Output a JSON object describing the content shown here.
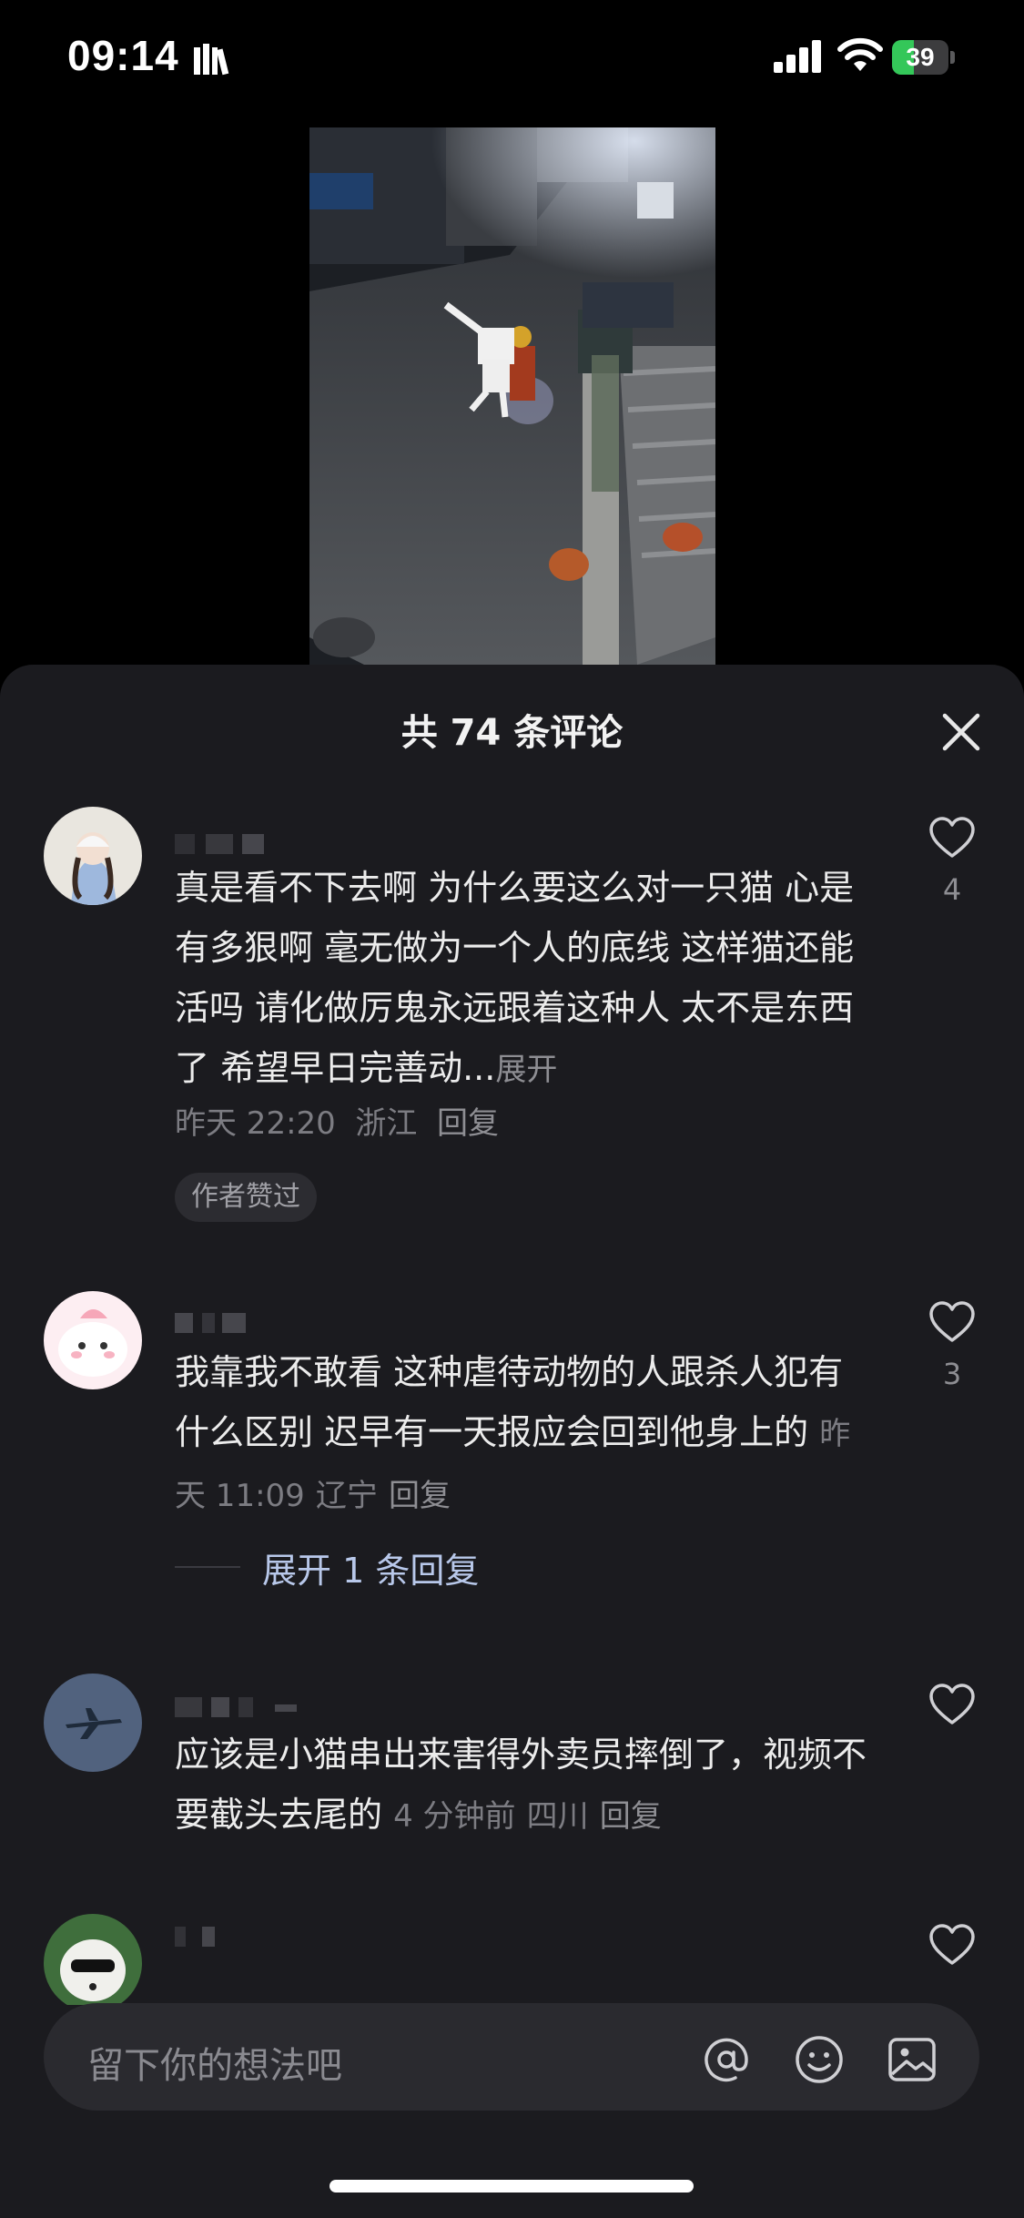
{
  "status_bar": {
    "time": "09:14",
    "battery": "39",
    "battery_level": 0.39
  },
  "comments_sheet": {
    "title": "共 74 条评论",
    "comments": [
      {
        "text": "真是看不下去啊 为什么要这么对一只猫 心是有多狠啊 毫无做为一个人的底线 这样猫还能活吗 请化做厉鬼永远跟着这种人 太不是东西了 希望早日完善动...",
        "expand": "展开",
        "time": "昨天 22:20",
        "location": "浙江",
        "reply": "回复",
        "likes": "4",
        "badge": "作者赞过"
      },
      {
        "text": "我靠我不敢看 这种虐待动物的人跟杀人犯有什么区别 迟早有一天报应会回到他身上的",
        "time": "昨天 11:09",
        "location": "辽宁",
        "reply": "回复",
        "likes": "3",
        "expand_replies": "展开 1 条回复"
      },
      {
        "text": "应该是小猫串出来害得外卖员摔倒了，视频不要截头去尾的",
        "time": "4 分钟前",
        "location": "四川",
        "reply": "回复"
      },
      {}
    ]
  },
  "input": {
    "placeholder": "留下你的想法吧"
  },
  "icons": [
    "books-icon",
    "signal-icon",
    "wifi-icon",
    "battery-icon",
    "close-icon",
    "heart-icon",
    "at-icon",
    "emoji-icon",
    "image-icon"
  ],
  "colors": {
    "sheet_bg": "#1b1b1f",
    "battery_green": "#34c759",
    "reply_link": "#b8c8ea"
  }
}
